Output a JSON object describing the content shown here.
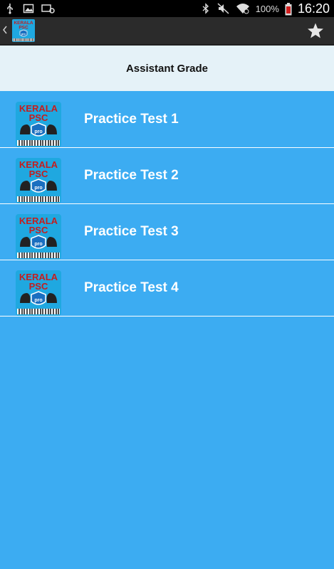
{
  "statusbar": {
    "battery_percent": "100%",
    "time": "16:20",
    "icons": [
      "usb-icon",
      "image-icon",
      "key-icon",
      "bluetooth-icon",
      "mute-icon",
      "wifi-icon",
      "battery-icon"
    ]
  },
  "actionbar": {
    "logo_text_top": "KERALA",
    "logo_text_bottom": "PSC",
    "logo_badge": "pro",
    "favorite_icon": "star-icon"
  },
  "header": {
    "title": "Assistant Grade"
  },
  "list": {
    "items": [
      {
        "label": "Practice Test 1",
        "icon_top": "KERALA",
        "icon_bottom": "PSC",
        "icon_badge": "pro"
      },
      {
        "label": "Practice Test 2",
        "icon_top": "KERALA",
        "icon_bottom": "PSC",
        "icon_badge": "pro"
      },
      {
        "label": "Practice Test 3",
        "icon_top": "KERALA",
        "icon_bottom": "PSC",
        "icon_badge": "pro"
      },
      {
        "label": "Practice Test 4",
        "icon_top": "KERALA",
        "icon_bottom": "PSC",
        "icon_badge": "pro"
      }
    ]
  },
  "colors": {
    "list_background": "#3cacf2",
    "header_background": "#e5f2f8",
    "actionbar_background": "#2b2b2b",
    "statusbar_background": "#000000"
  }
}
